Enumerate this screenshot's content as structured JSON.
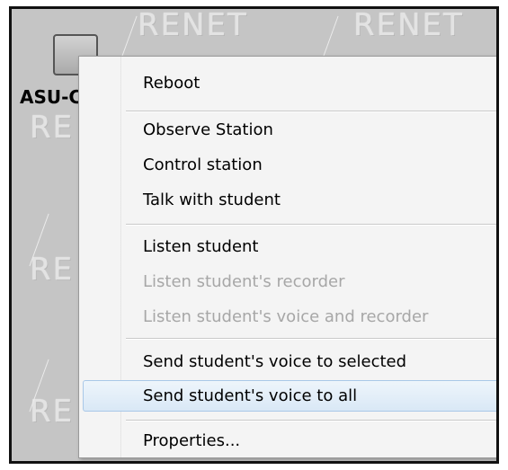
{
  "background": {
    "watermark_text": "RENET",
    "partial_watermark": "RE",
    "station_label": "ASU-C"
  },
  "context_menu": {
    "items": [
      {
        "label": "Reboot",
        "enabled": true
      },
      {
        "label": "Observe Station",
        "enabled": true
      },
      {
        "label": "Control station",
        "enabled": true
      },
      {
        "label": "Talk with student",
        "enabled": true
      },
      {
        "label": "Listen student",
        "enabled": true
      },
      {
        "label": "Listen student's recorder",
        "enabled": false
      },
      {
        "label": "Listen student's voice and recorder",
        "enabled": false
      },
      {
        "label": "Send student's voice to selected",
        "enabled": true
      },
      {
        "label": "Send student's voice to all",
        "enabled": true,
        "highlighted": true
      },
      {
        "label": "Properties...",
        "enabled": true
      }
    ]
  },
  "colors": {
    "highlight": "#d9e8f6",
    "disabled_text": "#a7a7a7",
    "menu_background": "#f4f4f4"
  }
}
